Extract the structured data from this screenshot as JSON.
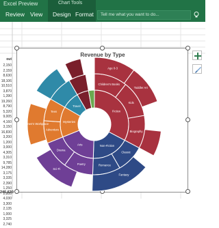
{
  "window": {
    "app_title": "Excel Preview",
    "context_tab_group": "Chart Tools"
  },
  "ribbon": {
    "tabs": [
      "Review",
      "View",
      "Design",
      "Format"
    ],
    "tell_me_placeholder": "Tell me what you want to do...",
    "icons": [
      "lightbulb-icon"
    ]
  },
  "sheet": {
    "column_header_fragment": "out",
    "row_values": [
      "2,150",
      "2,159",
      "8,630",
      "18,106",
      "10,510",
      "3,870",
      "1,390",
      "19,260",
      "8,790",
      "5,320",
      "9,005",
      "4,160",
      "3,150",
      "16,830",
      "3,200",
      "1,200",
      "3,000",
      "4,305",
      "3,310",
      "9,785",
      "14,280",
      "3,175",
      "3,335",
      "2,390",
      "1,250",
      "2,335",
      "4,030",
      "3,300",
      "2,135",
      "1,000",
      "3,325",
      "2,740"
    ],
    "total": "245,630"
  },
  "chart": {
    "title": "Revenue by Type",
    "colors": {
      "red": "#a8323f",
      "blue": "#2e4a86",
      "purple": "#6f3f96",
      "orange": "#e07a2f",
      "teal": "#2f8aa8",
      "darkred": "#7a1f2b",
      "green": "#6aa84f"
    }
  },
  "chart_data": {
    "type": "sunburst",
    "title": "Revenue by Type",
    "labels_visible": [
      "Fiction",
      "Mysteries",
      "Children's Books",
      "Non-Fiction",
      "Kids",
      "Arts",
      "Age 0-3",
      "Toddler Art",
      "Biography",
      "Travel",
      "Classic",
      "Romance",
      "Poetry",
      "Drama",
      "Sci-Fi",
      "Fantasy",
      "Women's Workplace",
      "Teen",
      "Adventure"
    ]
  },
  "side_buttons": [
    "chart-elements-button",
    "chart-styles-button"
  ]
}
